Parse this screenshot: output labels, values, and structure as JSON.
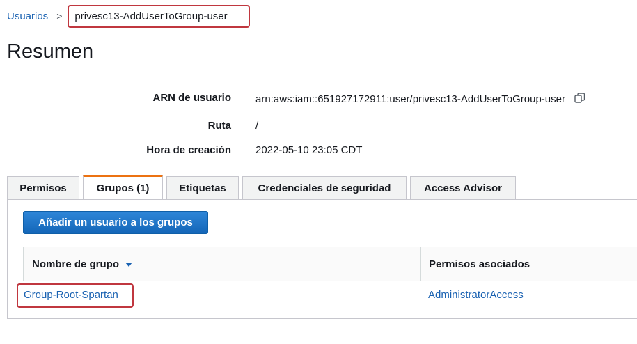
{
  "breadcrumb": {
    "parent": "Usuarios",
    "separator": ">",
    "current": "privesc13-AddUserToGroup-user"
  },
  "page_title": "Resumen",
  "summary": {
    "arn_label": "ARN de usuario",
    "arn_value": "arn:aws:iam::651927172911:user/privesc13-AddUserToGroup-user",
    "path_label": "Ruta",
    "path_value": "/",
    "created_label": "Hora de creación",
    "created_value": "2022-05-10 23:05 CDT"
  },
  "tabs": [
    {
      "label": "Permisos",
      "active": false
    },
    {
      "label": "Grupos (1)",
      "active": true
    },
    {
      "label": "Etiquetas",
      "active": false
    },
    {
      "label": "Credenciales de seguridad",
      "active": false
    },
    {
      "label": "Access Advisor",
      "active": false
    }
  ],
  "add_button_label": "Añadir un usuario a los grupos",
  "groups_table": {
    "headers": [
      "Nombre de grupo",
      "Permisos asociados"
    ],
    "sort_icon": "caret-down-icon",
    "rows": [
      {
        "group": "Group-Root-Spartan",
        "policies": "AdministratorAccess"
      }
    ]
  },
  "colors": {
    "link": "#1a62b2",
    "highlight_box": "#c0373f",
    "active_tab_accent": "#ec7211",
    "primary_button": "#1466b8"
  }
}
